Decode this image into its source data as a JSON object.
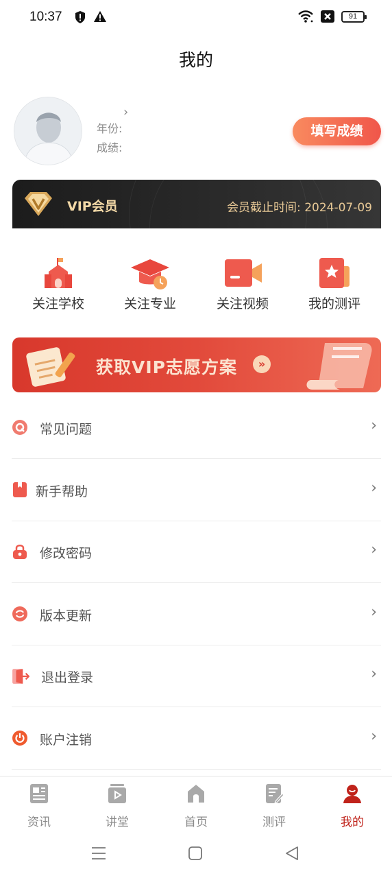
{
  "status_bar": {
    "time": "10:37",
    "battery": "91"
  },
  "page": {
    "title": "我的"
  },
  "profile": {
    "year_label": "年份:",
    "score_label": "成绩:",
    "fill_score_button": "填写成绩"
  },
  "vip": {
    "title": "VIP会员",
    "expire_text": "会员截止时间: 2024-07-09"
  },
  "shortcuts": [
    {
      "label": "关注学校",
      "icon": "school-icon"
    },
    {
      "label": "关注专业",
      "icon": "graduation-cap-icon"
    },
    {
      "label": "关注视频",
      "icon": "video-camera-icon"
    },
    {
      "label": "我的测评",
      "icon": "star-bookmark-icon"
    }
  ],
  "banner": {
    "text": "获取VIP志愿方案",
    "go_icon": "double-chevron-icon"
  },
  "menu": [
    {
      "label": "常见问题",
      "icon": "faq-icon"
    },
    {
      "label": "新手帮助",
      "icon": "help-book-icon"
    },
    {
      "label": "修改密码",
      "icon": "lock-icon"
    },
    {
      "label": "版本更新",
      "icon": "refresh-icon"
    },
    {
      "label": "退出登录",
      "icon": "logout-icon"
    },
    {
      "label": "账户注销",
      "icon": "power-icon"
    }
  ],
  "tabs": [
    {
      "label": "资讯",
      "icon": "news-icon"
    },
    {
      "label": "讲堂",
      "icon": "lecture-icon"
    },
    {
      "label": "首页",
      "icon": "home-icon"
    },
    {
      "label": "测评",
      "icon": "evaluation-icon"
    },
    {
      "label": "我的",
      "icon": "profile-icon",
      "active": true
    }
  ],
  "colors": {
    "accent": "#c0231b",
    "brand_red": "#e24a3b",
    "vip_gold": "#f3d9a7"
  }
}
